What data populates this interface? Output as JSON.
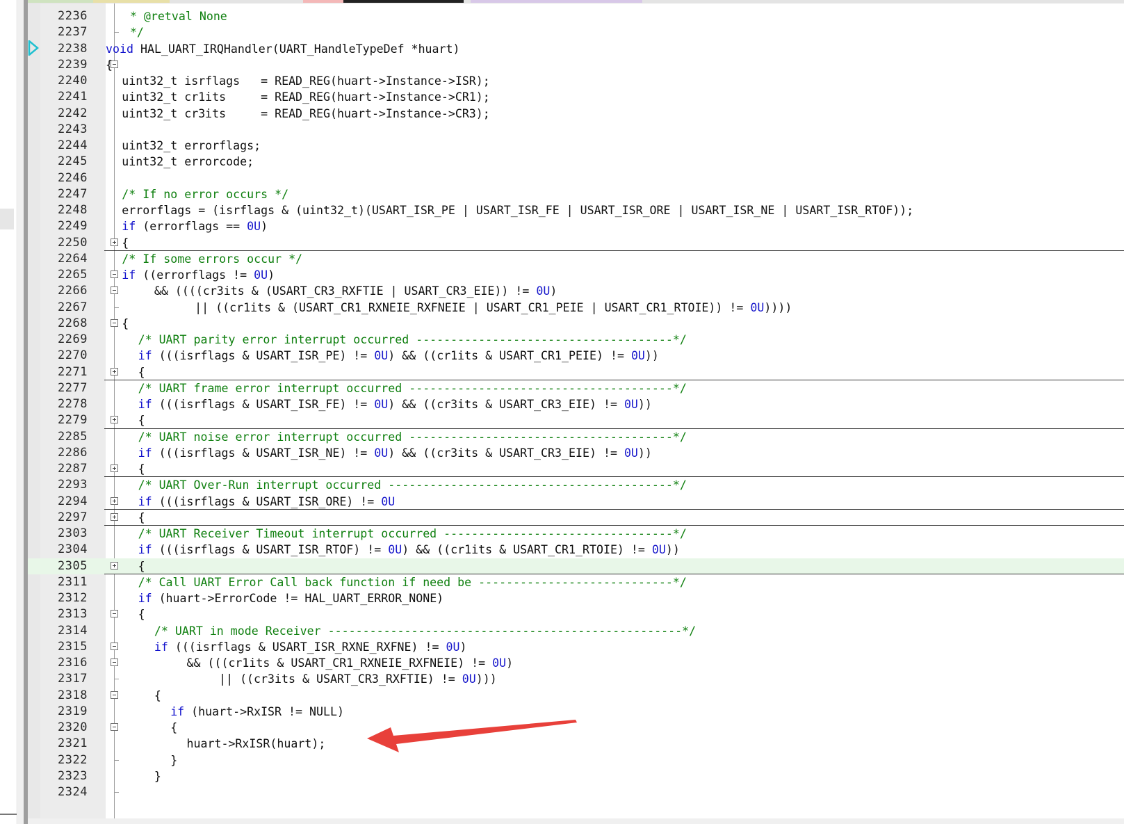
{
  "editor": {
    "lines": [
      {
        "num": "2236",
        "indent": 3,
        "fold": "",
        "tokens": [
          {
            "t": "cm",
            "v": "* @retval None"
          }
        ]
      },
      {
        "num": "2237",
        "indent": 3,
        "fold": "end",
        "tokens": [
          {
            "t": "cm",
            "v": "*/"
          }
        ]
      },
      {
        "num": "2238",
        "indent": 0,
        "fold": "",
        "tokens": [
          {
            "t": "kw",
            "v": "void"
          },
          {
            "t": "tx",
            "v": " HAL_UART_IRQHandler(UART_HandleTypeDef *huart)"
          }
        ]
      },
      {
        "num": "2239",
        "indent": 0,
        "fold": "minus",
        "tokens": [
          {
            "t": "tx",
            "v": "{"
          }
        ]
      },
      {
        "num": "2240",
        "indent": 2,
        "fold": "",
        "tokens": [
          {
            "t": "tx",
            "v": "uint32_t isrflags   = READ_REG(huart->Instance->ISR);"
          }
        ]
      },
      {
        "num": "2241",
        "indent": 2,
        "fold": "",
        "tokens": [
          {
            "t": "tx",
            "v": "uint32_t cr1its     = READ_REG(huart->Instance->CR1);"
          }
        ]
      },
      {
        "num": "2242",
        "indent": 2,
        "fold": "",
        "tokens": [
          {
            "t": "tx",
            "v": "uint32_t cr3its     = READ_REG(huart->Instance->CR3);"
          }
        ]
      },
      {
        "num": "2243",
        "indent": 0,
        "fold": "",
        "tokens": []
      },
      {
        "num": "2244",
        "indent": 2,
        "fold": "",
        "tokens": [
          {
            "t": "tx",
            "v": "uint32_t errorflags;"
          }
        ]
      },
      {
        "num": "2245",
        "indent": 2,
        "fold": "",
        "tokens": [
          {
            "t": "tx",
            "v": "uint32_t errorcode;"
          }
        ]
      },
      {
        "num": "2246",
        "indent": 0,
        "fold": "",
        "tokens": []
      },
      {
        "num": "2247",
        "indent": 2,
        "fold": "",
        "tokens": [
          {
            "t": "cm",
            "v": "/* If no error occurs */"
          }
        ]
      },
      {
        "num": "2248",
        "indent": 2,
        "fold": "",
        "tokens": [
          {
            "t": "tx",
            "v": "errorflags = (isrflags & (uint32_t)(USART_ISR_PE | USART_ISR_FE | USART_ISR_ORE | USART_ISR_NE | USART_ISR_RTOF));"
          }
        ]
      },
      {
        "num": "2249",
        "indent": 2,
        "fold": "",
        "tokens": [
          {
            "t": "kw",
            "v": "if"
          },
          {
            "t": "tx",
            "v": " (errorflags == "
          },
          {
            "t": "num",
            "v": "0U"
          },
          {
            "t": "tx",
            "v": ")"
          }
        ]
      },
      {
        "num": "2250",
        "indent": 2,
        "fold": "plus",
        "sep": true,
        "tokens": [
          {
            "t": "tx",
            "v": "{"
          }
        ]
      },
      {
        "num": "2264",
        "indent": 2,
        "fold": "",
        "tokens": [
          {
            "t": "cm",
            "v": "/* If some errors occur */"
          }
        ]
      },
      {
        "num": "2265",
        "indent": 2,
        "fold": "minus",
        "tokens": [
          {
            "t": "kw",
            "v": "if"
          },
          {
            "t": "tx",
            "v": " ((errorflags != "
          },
          {
            "t": "num",
            "v": "0U"
          },
          {
            "t": "tx",
            "v": ")"
          }
        ]
      },
      {
        "num": "2266",
        "indent": 6,
        "fold": "minus",
        "tokens": [
          {
            "t": "tx",
            "v": "&& ((((cr3its & (USART_CR3_RXFTIE | USART_CR3_EIE)) != "
          },
          {
            "t": "num",
            "v": "0U"
          },
          {
            "t": "tx",
            "v": ")"
          }
        ]
      },
      {
        "num": "2267",
        "indent": 11,
        "fold": "end",
        "tokens": [
          {
            "t": "tx",
            "v": "|| ((cr1its & (USART_CR1_RXNEIE_RXFNEIE | USART_CR1_PEIE | USART_CR1_RTOIE)) != "
          },
          {
            "t": "num",
            "v": "0U"
          },
          {
            "t": "tx",
            "v": "))))"
          }
        ]
      },
      {
        "num": "2268",
        "indent": 2,
        "fold": "minus",
        "tokens": [
          {
            "t": "tx",
            "v": "{"
          }
        ]
      },
      {
        "num": "2269",
        "indent": 4,
        "fold": "",
        "tokens": [
          {
            "t": "cm",
            "v": "/* UART parity error interrupt occurred -------------------------------------*/"
          }
        ]
      },
      {
        "num": "2270",
        "indent": 4,
        "fold": "",
        "tokens": [
          {
            "t": "kw",
            "v": "if"
          },
          {
            "t": "tx",
            "v": " (((isrflags & USART_ISR_PE) != "
          },
          {
            "t": "num",
            "v": "0U"
          },
          {
            "t": "tx",
            "v": ") && ((cr1its & USART_CR1_PEIE) != "
          },
          {
            "t": "num",
            "v": "0U"
          },
          {
            "t": "tx",
            "v": "))"
          }
        ]
      },
      {
        "num": "2271",
        "indent": 4,
        "fold": "plus",
        "sep": true,
        "tokens": [
          {
            "t": "tx",
            "v": "{"
          }
        ]
      },
      {
        "num": "2277",
        "indent": 4,
        "fold": "",
        "tokens": [
          {
            "t": "cm",
            "v": "/* UART frame error interrupt occurred --------------------------------------*/"
          }
        ]
      },
      {
        "num": "2278",
        "indent": 4,
        "fold": "",
        "tokens": [
          {
            "t": "kw",
            "v": "if"
          },
          {
            "t": "tx",
            "v": " (((isrflags & USART_ISR_FE) != "
          },
          {
            "t": "num",
            "v": "0U"
          },
          {
            "t": "tx",
            "v": ") && ((cr3its & USART_CR3_EIE) != "
          },
          {
            "t": "num",
            "v": "0U"
          },
          {
            "t": "tx",
            "v": "))"
          }
        ]
      },
      {
        "num": "2279",
        "indent": 4,
        "fold": "plus",
        "sep": true,
        "tokens": [
          {
            "t": "tx",
            "v": "{"
          }
        ]
      },
      {
        "num": "2285",
        "indent": 4,
        "fold": "",
        "tokens": [
          {
            "t": "cm",
            "v": "/* UART noise error interrupt occurred --------------------------------------*/"
          }
        ]
      },
      {
        "num": "2286",
        "indent": 4,
        "fold": "",
        "tokens": [
          {
            "t": "kw",
            "v": "if"
          },
          {
            "t": "tx",
            "v": " (((isrflags & USART_ISR_NE) != "
          },
          {
            "t": "num",
            "v": "0U"
          },
          {
            "t": "tx",
            "v": ") && ((cr3its & USART_CR3_EIE) != "
          },
          {
            "t": "num",
            "v": "0U"
          },
          {
            "t": "tx",
            "v": "))"
          }
        ]
      },
      {
        "num": "2287",
        "indent": 4,
        "fold": "plus",
        "sep": true,
        "tokens": [
          {
            "t": "tx",
            "v": "{"
          }
        ]
      },
      {
        "num": "2293",
        "indent": 4,
        "fold": "",
        "tokens": [
          {
            "t": "cm",
            "v": "/* UART Over-Run interrupt occurred -----------------------------------------*/"
          }
        ]
      },
      {
        "num": "2294",
        "indent": 4,
        "fold": "plus",
        "sep": true,
        "tokens": [
          {
            "t": "kw",
            "v": "if"
          },
          {
            "t": "tx",
            "v": " (((isrflags & USART_ISR_ORE) != "
          },
          {
            "t": "num",
            "v": "0U"
          }
        ]
      },
      {
        "num": "2297",
        "indent": 4,
        "fold": "plus",
        "sep": true,
        "tokens": [
          {
            "t": "tx",
            "v": "{"
          }
        ]
      },
      {
        "num": "2303",
        "indent": 4,
        "fold": "",
        "tokens": [
          {
            "t": "cm",
            "v": "/* UART Receiver Timeout interrupt occurred ---------------------------------*/"
          }
        ]
      },
      {
        "num": "2304",
        "indent": 4,
        "fold": "",
        "tokens": [
          {
            "t": "kw",
            "v": "if"
          },
          {
            "t": "tx",
            "v": " (((isrflags & USART_ISR_RTOF) != "
          },
          {
            "t": "num",
            "v": "0U"
          },
          {
            "t": "tx",
            "v": ") && ((cr1its & USART_CR1_RTOIE) != "
          },
          {
            "t": "num",
            "v": "0U"
          },
          {
            "t": "tx",
            "v": "))"
          }
        ]
      },
      {
        "num": "2305",
        "indent": 4,
        "fold": "plus",
        "sep": true,
        "hl": true,
        "tokens": [
          {
            "t": "tx",
            "v": "{"
          }
        ]
      },
      {
        "num": "2311",
        "indent": 4,
        "fold": "",
        "tokens": [
          {
            "t": "cm",
            "v": "/* Call UART Error Call back function if need be ----------------------------*/"
          }
        ]
      },
      {
        "num": "2312",
        "indent": 4,
        "fold": "",
        "tokens": [
          {
            "t": "kw",
            "v": "if"
          },
          {
            "t": "tx",
            "v": " (huart->ErrorCode != HAL_UART_ERROR_NONE)"
          }
        ]
      },
      {
        "num": "2313",
        "indent": 4,
        "fold": "minus",
        "tokens": [
          {
            "t": "tx",
            "v": "{"
          }
        ]
      },
      {
        "num": "2314",
        "indent": 6,
        "fold": "",
        "tokens": [
          {
            "t": "cm",
            "v": "/* UART in mode Receiver ---------------------------------------------------*/"
          }
        ]
      },
      {
        "num": "2315",
        "indent": 6,
        "fold": "minus",
        "tokens": [
          {
            "t": "kw",
            "v": "if"
          },
          {
            "t": "tx",
            "v": " (((isrflags & USART_ISR_RXNE_RXFNE) != "
          },
          {
            "t": "num",
            "v": "0U"
          },
          {
            "t": "tx",
            "v": ")"
          }
        ]
      },
      {
        "num": "2316",
        "indent": 10,
        "fold": "minus",
        "tokens": [
          {
            "t": "tx",
            "v": "&& (((cr1its & USART_CR1_RXNEIE_RXFNEIE) != "
          },
          {
            "t": "num",
            "v": "0U"
          },
          {
            "t": "tx",
            "v": ")"
          }
        ]
      },
      {
        "num": "2317",
        "indent": 14,
        "fold": "end",
        "tokens": [
          {
            "t": "tx",
            "v": "|| ((cr3its & USART_CR3_RXFTIE) != "
          },
          {
            "t": "num",
            "v": "0U"
          },
          {
            "t": "tx",
            "v": ")))"
          }
        ]
      },
      {
        "num": "2318",
        "indent": 6,
        "fold": "minus",
        "tokens": [
          {
            "t": "tx",
            "v": "{"
          }
        ]
      },
      {
        "num": "2319",
        "indent": 8,
        "fold": "",
        "tokens": [
          {
            "t": "kw",
            "v": "if"
          },
          {
            "t": "tx",
            "v": " (huart->RxISR != NULL)"
          }
        ]
      },
      {
        "num": "2320",
        "indent": 8,
        "fold": "minus",
        "tokens": [
          {
            "t": "tx",
            "v": "{"
          }
        ]
      },
      {
        "num": "2321",
        "indent": 10,
        "fold": "",
        "tokens": [
          {
            "t": "tx",
            "v": "huart->RxISR(huart);"
          }
        ]
      },
      {
        "num": "2322",
        "indent": 8,
        "fold": "end",
        "tokens": [
          {
            "t": "tx",
            "v": "}"
          }
        ]
      },
      {
        "num": "2323",
        "indent": 6,
        "fold": "",
        "tokens": [
          {
            "t": "tx",
            "v": "}"
          }
        ]
      },
      {
        "num": "2324",
        "indent": 0,
        "fold": "end",
        "tokens": []
      }
    ]
  },
  "colors": {
    "keyword": "#1010cc",
    "number": "#1a1acc",
    "comment": "#108010",
    "text": "#111111",
    "highlight_row": "#e8f7e8",
    "annotation_arrow": "#e8403a",
    "exec_arrow": "#20c0d0"
  },
  "tab_colors": [
    "#cfe3c0",
    "#e8e0a8",
    "#f4b8b8",
    "#222222",
    "#d8c8e8"
  ],
  "icons": {
    "execution_marker": "current-line-arrow-icon",
    "annotation": "red-arrow-icon"
  }
}
